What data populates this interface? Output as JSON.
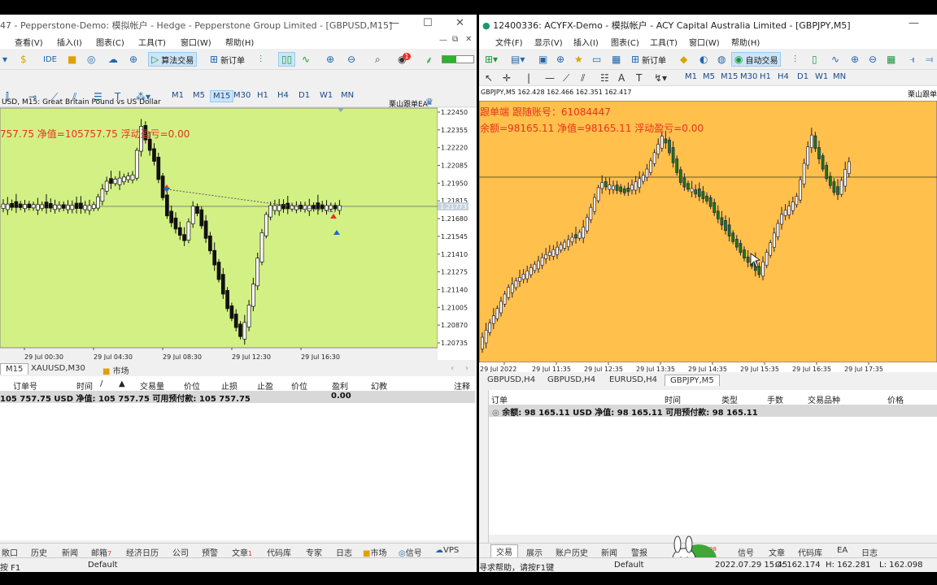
{
  "left": {
    "title": "47 - Pepperstone-Demo: 模拟帐户 - Hedge - Pepperstone Group Limited - [GBPUSD,M15]",
    "menu": [
      "查看(V)",
      "插入(I)",
      "图表(C)",
      "工具(T)",
      "窗口(W)",
      "帮助(H)"
    ],
    "toolbar": {
      "ide": "IDE",
      "algo_trading": "算法交易",
      "new_order": "新订单",
      "badge": "1"
    },
    "timeframes": [
      "M1",
      "M5",
      "M15",
      "M30",
      "H1",
      "H4",
      "D1",
      "W1",
      "MN"
    ],
    "active_tf": "M15",
    "chart": {
      "header": "USD, M15:  Great Britain Pound vs US Dollar",
      "ea_label": "栗山跟单EA",
      "info_line": "757.75   净值=105757.75   浮动盈亏=0.00",
      "bg": "#d3f085",
      "price_labels": [
        "1.22450",
        "1.22355",
        "1.22220",
        "1.22085",
        "1.21950",
        "1.21815",
        "1.21680",
        "1.21545",
        "1.21410",
        "1.21275",
        "1.21140",
        "1.21005",
        "1.20870",
        "1.20735"
      ],
      "current_price": "1.21773",
      "time_labels": [
        "29 Jul 00:30",
        "29 Jul 04:30",
        "29 Jul 08:30",
        "29 Jul 12:30",
        "29 Jul 16:30"
      ]
    },
    "chart_tabs": [
      "M15",
      "XAUUSD,M30",
      "市场"
    ],
    "terminal": {
      "columns": [
        "订单号",
        "时间",
        "/",
        "交易量",
        "价位",
        "止损",
        "止盈",
        "价位",
        "盈利",
        "幻教",
        "注释"
      ],
      "balance": "105 757.75 USD  净值: 105 757.75  可用预付款: 105 757.75",
      "profit": "0.00"
    },
    "bottom_tabs": [
      "敞口",
      "历史",
      "新闻",
      "邮箱",
      "经济日历",
      "公司",
      "预警",
      "文章",
      "代码库",
      "专家",
      "日志",
      "市场",
      "信号",
      "VPS"
    ],
    "mail_count": "7",
    "article_count": "1",
    "status": {
      "help": "按 F1",
      "profile": "Default"
    }
  },
  "right": {
    "title": "12400336: ACYFX-Demo - 模拟帐户 - ACY Capital Australia Limited - [GBPJPY,M5]",
    "menu": [
      "文件(F)",
      "显示(V)",
      "插入(I)",
      "图表(C)",
      "工具(T)",
      "窗口(W)",
      "帮助(H)"
    ],
    "toolbar": {
      "new_order": "新订单",
      "auto_trading": "自动交易"
    },
    "timeframes": [
      "M1",
      "M5",
      "M15",
      "M30",
      "H1",
      "H4",
      "D1",
      "W1",
      "MN"
    ],
    "chart": {
      "header": "GBPJPY,M5  162.428 162.466 162.351 162.417",
      "ea_label": "栗山跟单E",
      "line1": "跟单端   跟随账号：61084447",
      "line2": "余额=98165.11   净值=98165.11   浮动盈亏=0.00",
      "bg": "#ffc04c",
      "time_labels": [
        "29 Jul 2022",
        "29 Jul 11:35",
        "29 Jul 12:35",
        "29 Jul 13:35",
        "29 Jul 14:35",
        "29 Jul 15:35",
        "29 Jul 16:35",
        "29 Jul 17:35"
      ]
    },
    "chart_tabs": [
      "GBPUSD,H4",
      "GBPUSD,H4",
      "EURUSD,H4",
      "GBPJPY,M5"
    ],
    "terminal": {
      "columns": [
        "订单",
        "时间",
        "类型",
        "手数",
        "交易品种",
        "价格"
      ],
      "balance": "余额: 98 165.11 USD  净值: 98 165.11  可用预付款: 98 165.11"
    },
    "bottom_tabs": [
      "交易",
      "展示",
      "账户历史",
      "新闻",
      "警报",
      "信号",
      "文章",
      "代码库",
      "EA",
      "日志"
    ],
    "bottom_badge": "98",
    "status": {
      "help": "寻求帮助，请按F1键",
      "profile": "Default",
      "time": "2022.07.29 15:45",
      "open": "O: 162.174",
      "high": "H: 162.281",
      "low": "L: 162.098"
    }
  }
}
